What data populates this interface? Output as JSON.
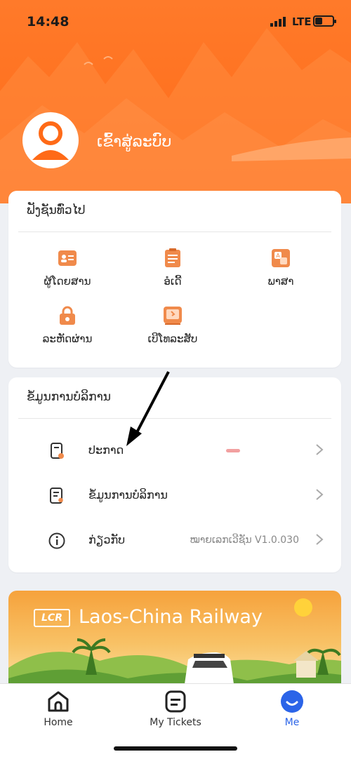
{
  "status_bar": {
    "time": "14:48",
    "network": "LTE"
  },
  "profile": {
    "login_label": "ເຂົ້າສູ່ລະບົບ"
  },
  "general_settings": {
    "title": "ຟັງຊັນທົ່ວໄປ",
    "items": [
      {
        "label": "ຜູ້ໂດຍສານ",
        "icon": "passenger-icon"
      },
      {
        "label": "ອໍເດີ້",
        "icon": "order-icon"
      },
      {
        "label": "ພາສາ",
        "icon": "language-icon"
      },
      {
        "label": "ລະຫັດຜ່ານ",
        "icon": "password-lock-icon"
      },
      {
        "label": "ເບີໂທລະສັບ",
        "icon": "phone-icon"
      }
    ]
  },
  "service_info": {
    "title": "ຂໍ້ມູນການບໍລິການ",
    "rows": [
      {
        "label": "ປະກາດ",
        "icon": "announcement-icon",
        "value": ""
      },
      {
        "label": "ຂໍ້ມູນການບໍລິການ",
        "icon": "service-info-icon",
        "value": ""
      },
      {
        "label": "ກ່ຽວກັບ",
        "icon": "info-icon",
        "value": "ໝາຍເລກເວີຊັນ V1.0.030"
      }
    ]
  },
  "banner": {
    "logo": "LCR",
    "title": "Laos-China Railway"
  },
  "tabbar": {
    "tabs": [
      {
        "label": "Home",
        "icon": "home-icon",
        "active": false
      },
      {
        "label": "My Tickets",
        "icon": "ticket-icon",
        "active": false
      },
      {
        "label": "Me",
        "icon": "me-icon",
        "active": true
      }
    ]
  },
  "colors": {
    "brand_orange": "#ff6a17",
    "icon_orange": "#f08a4b",
    "active_blue": "#2b64e8"
  }
}
